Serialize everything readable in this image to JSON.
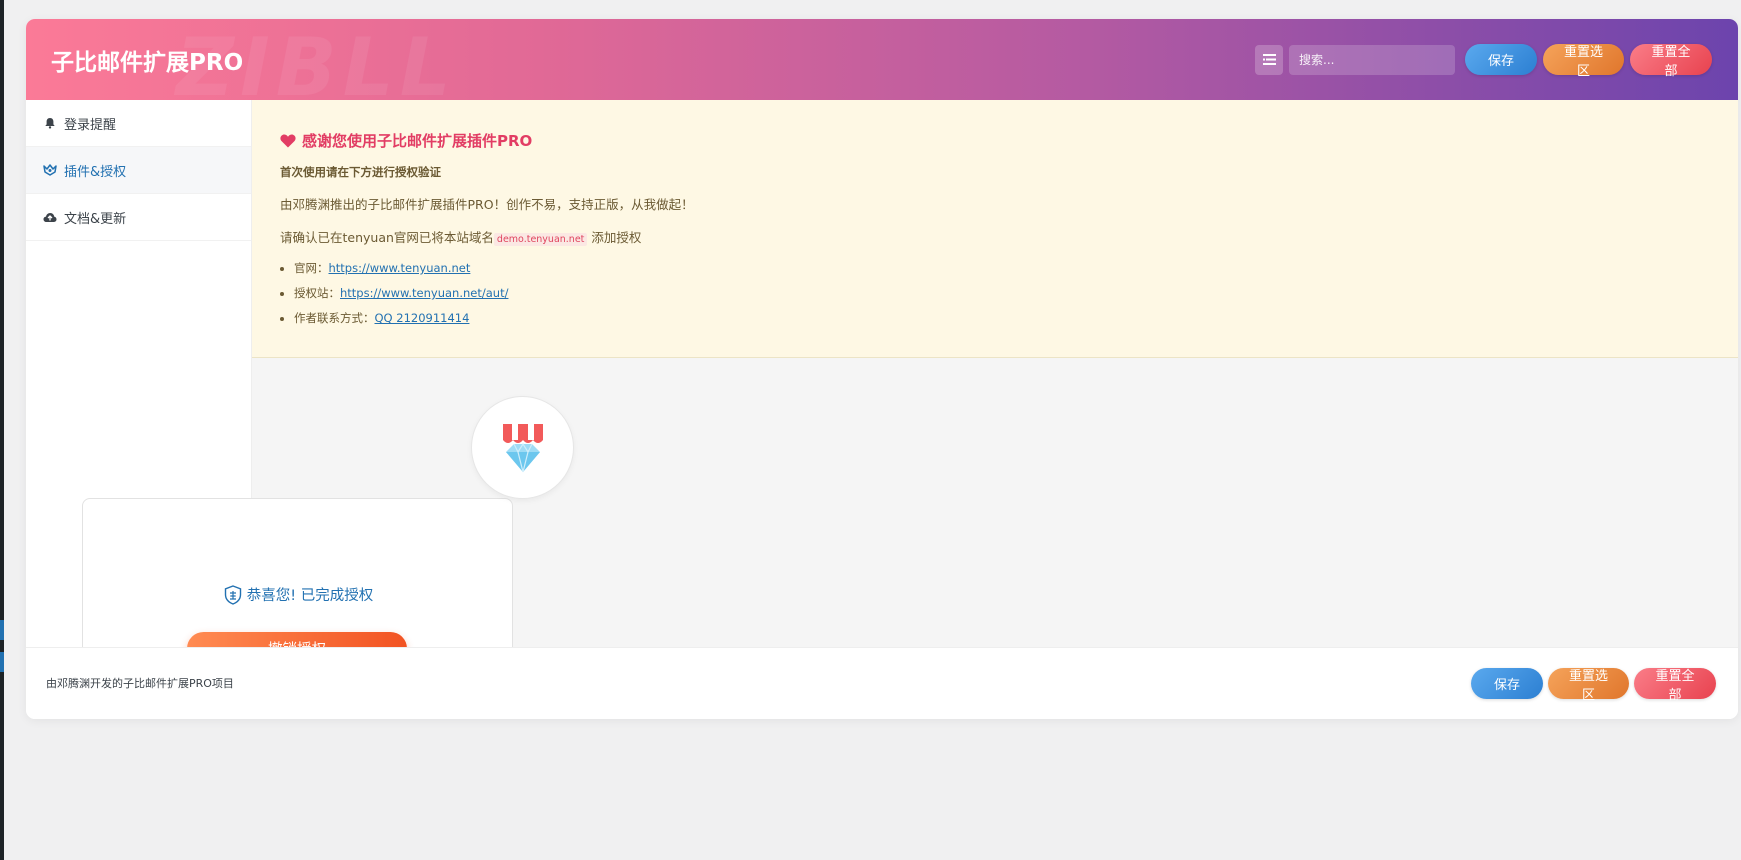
{
  "header": {
    "title": "子比邮件扩展PRO",
    "watermark": "ZIBLL",
    "search_placeholder": "搜索...",
    "save_label": "保存",
    "reset_section_label": "重置选区",
    "reset_all_label": "重置全部"
  },
  "sidebar": {
    "items": [
      {
        "label": "登录提醒",
        "icon": "bell-icon"
      },
      {
        "label": "插件&授权",
        "icon": "plugin-icon"
      },
      {
        "label": "文档&更新",
        "icon": "cloud-icon"
      }
    ]
  },
  "notice": {
    "title": "感谢您使用子比邮件扩展插件PRO",
    "subtitle": "首次使用请在下方进行授权验证",
    "line1": "由邓腾渊推出的子比邮件扩展插件PRO！创作不易，支持正版，从我做起！",
    "line2_prefix": "请确认已在tenyuan官网已将本站域名",
    "domain": "demo.tenyuan.net",
    "line2_suffix": "添加授权",
    "links": [
      {
        "label": "官网：",
        "text": "https://www.tenyuan.net"
      },
      {
        "label": "授权站：",
        "text": "https://www.tenyuan.net/aut/"
      },
      {
        "label": "作者联系方式：",
        "text": "QQ 2120911414"
      }
    ]
  },
  "auth_card": {
    "status_text": "恭喜您! 已完成授权",
    "revoke_label": "撤销授权"
  },
  "footer": {
    "text": "由邓腾渊开发的子比邮件扩展PRO项目",
    "save_label": "保存",
    "reset_section_label": "重置选区",
    "reset_all_label": "重置全部"
  },
  "colors": {
    "accent": "#2271b1",
    "notice_title": "#e23d64",
    "revoke": "#f25322"
  }
}
